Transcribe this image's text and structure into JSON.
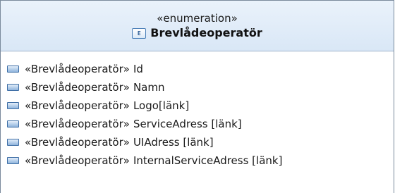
{
  "enumeration": {
    "stereotype": "«enumeration»",
    "icon_label": "E",
    "name": "Brevlådeoperatör",
    "literals": [
      {
        "stereotype": "«Brevlådeoperatör»",
        "name": "Id"
      },
      {
        "stereotype": "«Brevlådeoperatör»",
        "name": "Namn"
      },
      {
        "stereotype": "«Brevlådeoperatör»",
        "name": "Logo[länk]"
      },
      {
        "stereotype": "«Brevlådeoperatör»",
        "name": "ServiceAdress [länk]"
      },
      {
        "stereotype": "«Brevlådeoperatör»",
        "name": "UIAdress [länk]"
      },
      {
        "stereotype": "«Brevlådeoperatör»",
        "name": "InternalServiceAdress [länk]"
      }
    ]
  }
}
